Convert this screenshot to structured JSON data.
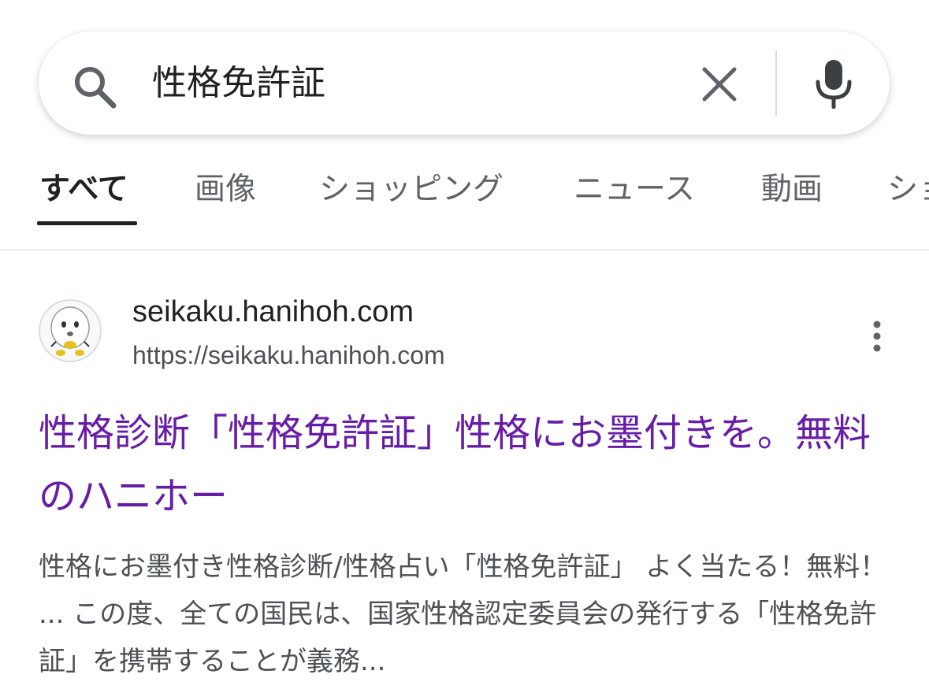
{
  "search": {
    "query": "性格免許証",
    "search_icon": "search-icon",
    "clear_icon": "close-icon",
    "mic_icon": "microphone-icon"
  },
  "tabs": [
    {
      "label": "すべて",
      "active": true
    },
    {
      "label": "画像",
      "active": false
    },
    {
      "label": "ショッピング",
      "active": false
    },
    {
      "label": "ニュース",
      "active": false
    },
    {
      "label": "動画",
      "active": false
    },
    {
      "label": "ショ",
      "active": false
    }
  ],
  "result": {
    "site_name": "seikaku.hanihoh.com",
    "url": "https://seikaku.hanihoh.com",
    "more_icon": "more-vertical-icon",
    "title": "性格診断「性格免許証」性格にお墨付きを。無料のハニホー",
    "snippet": "性格にお墨付き性格診断/性格占い「性格免許証」 よく当たる！無料！ ... この度、全ての国民は、国家性格認定委員会の発行する「性格免許証」を携帯することが義務..."
  },
  "colors": {
    "title_visited": "#681da8",
    "text_primary": "#202124",
    "text_secondary": "#4d5156",
    "tab_inactive": "#5f6368"
  }
}
